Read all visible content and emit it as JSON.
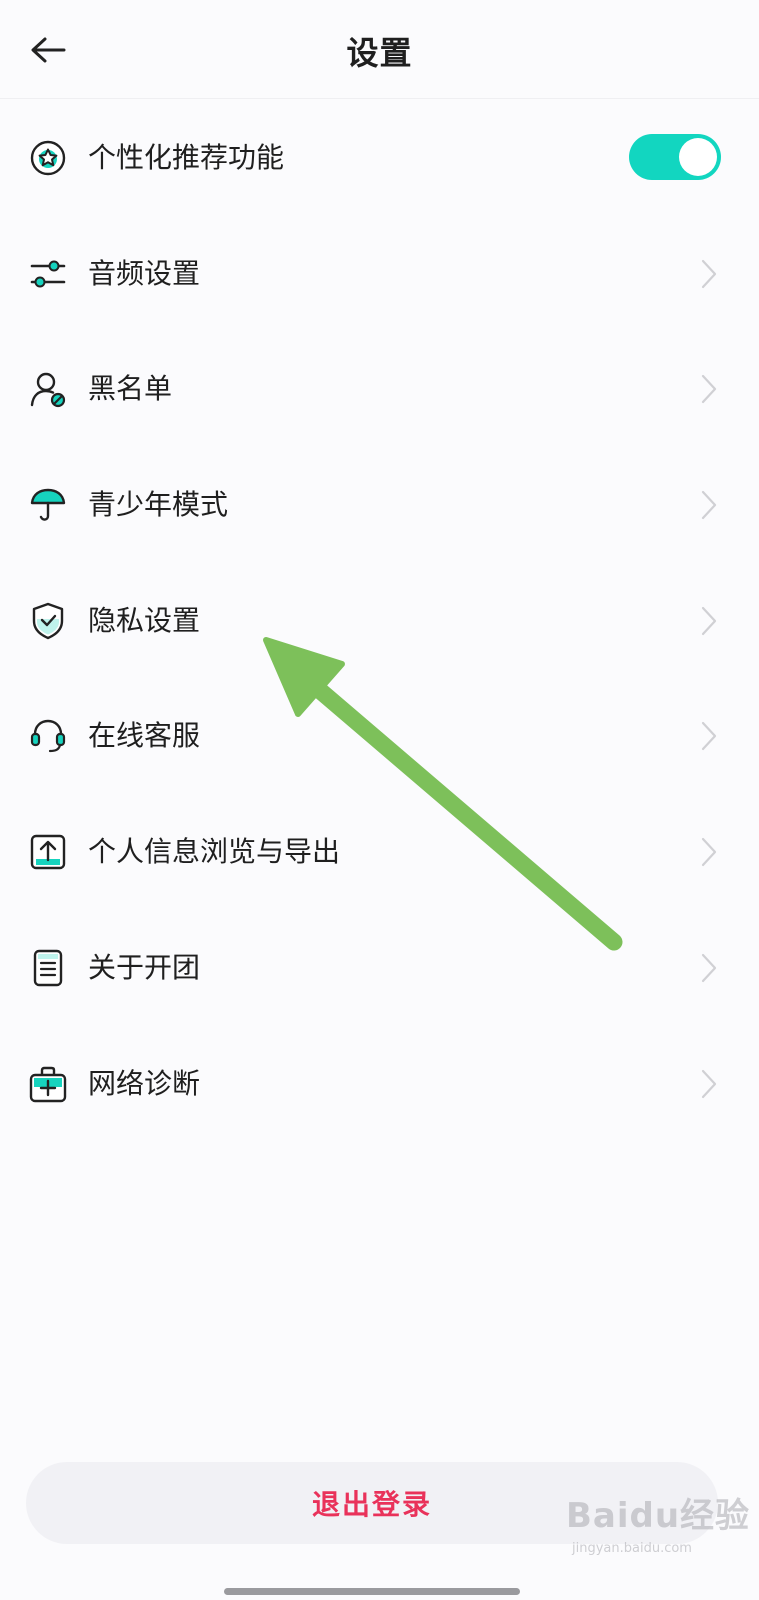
{
  "header": {
    "title": "设置",
    "back_icon": "arrow-left-icon"
  },
  "personalized_recommendation": {
    "label": "个性化推荐功能",
    "icon": "star-circle-icon",
    "toggle_on": true,
    "accent_color": "#12D6C0"
  },
  "menu": {
    "items": [
      {
        "label": "音频设置",
        "icon": "sliders-icon"
      },
      {
        "label": "黑名单",
        "icon": "user-blocked-icon"
      },
      {
        "label": "青少年模式",
        "icon": "umbrella-icon"
      },
      {
        "label": "隐私设置",
        "icon": "shield-check-icon"
      },
      {
        "label": "在线客服",
        "icon": "headset-icon"
      },
      {
        "label": "个人信息浏览与导出",
        "icon": "upload-box-icon"
      },
      {
        "label": "关于开团",
        "icon": "document-icon"
      },
      {
        "label": "网络诊断",
        "icon": "medical-kit-icon"
      }
    ]
  },
  "logout": {
    "label": "退出登录",
    "color": "#E9325A"
  },
  "annotation": {
    "arrow_color": "#7DC05A",
    "points_to": "隐私设置"
  },
  "watermark": {
    "main": "Baidu经验",
    "sub": "jingyan.baidu.com"
  }
}
